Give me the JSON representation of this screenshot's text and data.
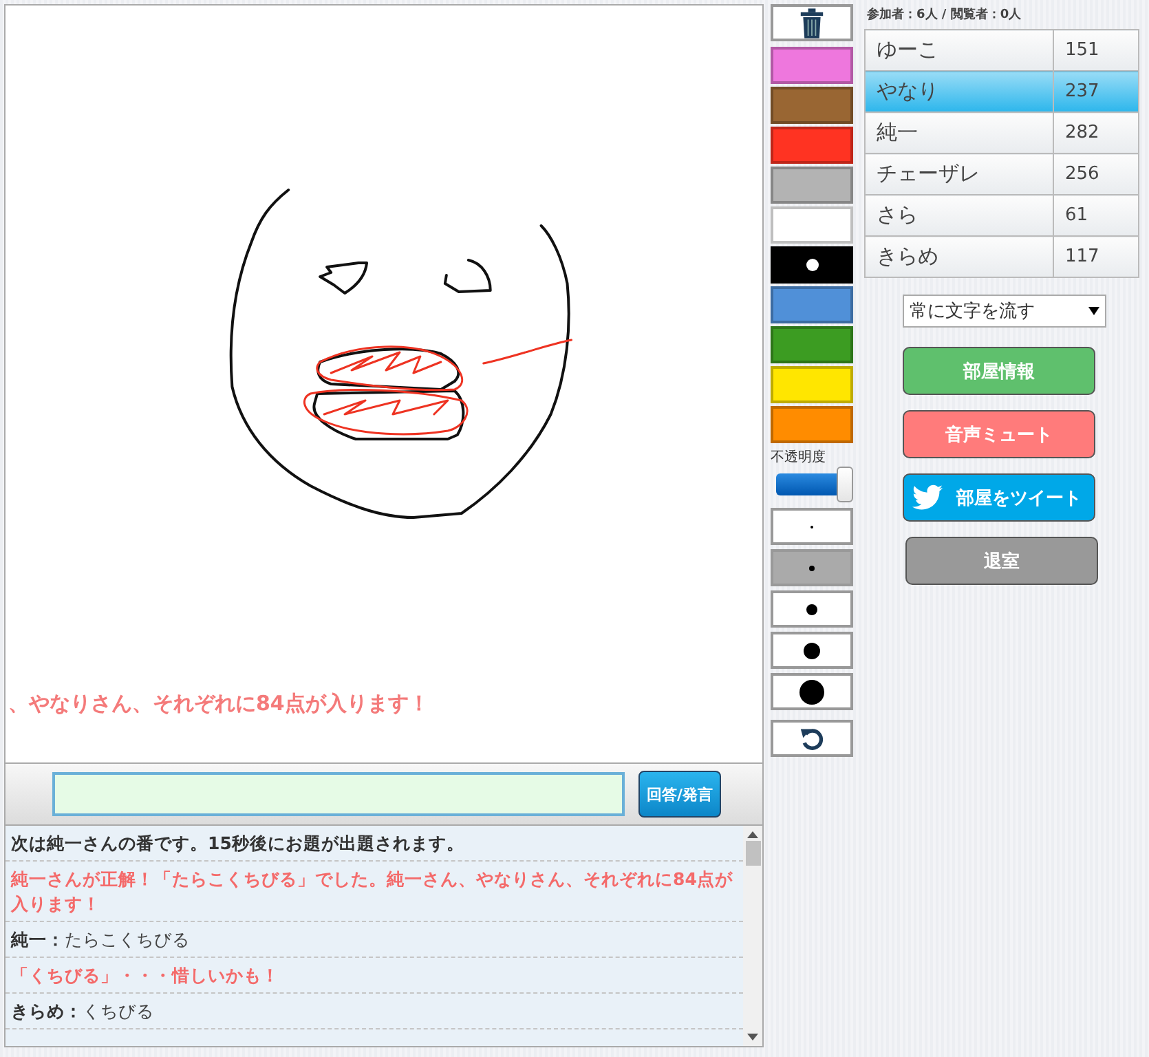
{
  "canvas": {
    "ticker": "、やなりさん、それぞれに84点が入ります！"
  },
  "answer_bar": {
    "button": "回答/発言"
  },
  "chat": [
    {
      "kind": "system",
      "text": "次は純一さんの番です。15秒後にお題が出題されます。"
    },
    {
      "kind": "alert",
      "text": "純一さんが正解！「たらこくちびる」でした。純一さん、やなりさん、それぞれに84点が入ります！"
    },
    {
      "kind": "message",
      "name": "純一：",
      "text": "たらこくちびる"
    },
    {
      "kind": "alert",
      "text": "「くちびる」・・・惜しいかも！"
    },
    {
      "kind": "message",
      "name": "きらめ：",
      "text": "くちびる"
    }
  ],
  "palette": [
    {
      "color": "#ee77dd",
      "selected": false
    },
    {
      "color": "#996633",
      "selected": false
    },
    {
      "color": "#ff3322",
      "selected": false
    },
    {
      "color": "#b3b3b3",
      "selected": false
    },
    {
      "color": "#ffffff",
      "selected": false
    },
    {
      "color": "#000000",
      "selected": true
    },
    {
      "color": "#5090d8",
      "selected": false
    },
    {
      "color": "#3c9c22",
      "selected": false
    },
    {
      "color": "#ffe600",
      "selected": false
    },
    {
      "color": "#ff8c00",
      "selected": false
    }
  ],
  "opacity": {
    "label": "不透明度",
    "level": 0.95
  },
  "brush_sizes": [
    {
      "selected": false
    },
    {
      "selected": true
    },
    {
      "selected": false
    },
    {
      "selected": false
    },
    {
      "selected": false
    }
  ],
  "counts": "参加者：6人 / 閲覧者：0人",
  "players": [
    {
      "name": "ゆーこ",
      "score": "151",
      "selected": false
    },
    {
      "name": "やなり",
      "score": "237",
      "selected": true
    },
    {
      "name": "純一",
      "score": "282",
      "selected": false
    },
    {
      "name": "チェーザレ",
      "score": "256",
      "selected": false
    },
    {
      "name": "さら",
      "score": "61",
      "selected": false
    },
    {
      "name": "きらめ",
      "score": "117",
      "selected": false
    }
  ],
  "text_mode": "常に文字を流す",
  "buttons": [
    {
      "kind": "info",
      "label": "部屋情報"
    },
    {
      "kind": "mute",
      "label": "音声ミュート"
    },
    {
      "kind": "tweet",
      "label": "部屋をツイート"
    },
    {
      "kind": "leave",
      "label": "退室"
    }
  ]
}
